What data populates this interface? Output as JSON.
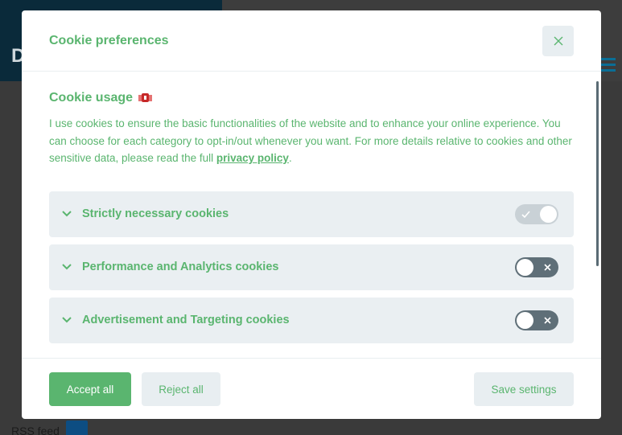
{
  "background": {
    "logo_text": "D",
    "rss_label": "RSS feed"
  },
  "modal": {
    "title": "Cookie preferences",
    "close_icon": "close-icon",
    "section": {
      "title": "Cookie usage",
      "title_icon": "cookie-flag-icon",
      "description_before_link": "I use cookies to ensure the basic functionalities of the website and to enhance your online experience. You can choose for each category to opt-in/out whenever you want. For more details relative to cookies and other sensitive data, please read the full ",
      "link_text": "privacy policy",
      "description_after_link": "."
    },
    "categories": [
      {
        "label": "Strictly necessary cookies",
        "enabled": true,
        "readonly": true
      },
      {
        "label": "Performance and Analytics cookies",
        "enabled": false,
        "readonly": false
      },
      {
        "label": "Advertisement and Targeting cookies",
        "enabled": false,
        "readonly": false
      }
    ],
    "buttons": {
      "accept_all": "Accept all",
      "reject_all": "Reject all",
      "save_settings": "Save settings"
    }
  },
  "colors": {
    "accent": "#5ab56f",
    "panel": "#eaeff2",
    "toggle_off": "#5f6f78",
    "toggle_on_disabled": "#c9d1d6"
  }
}
